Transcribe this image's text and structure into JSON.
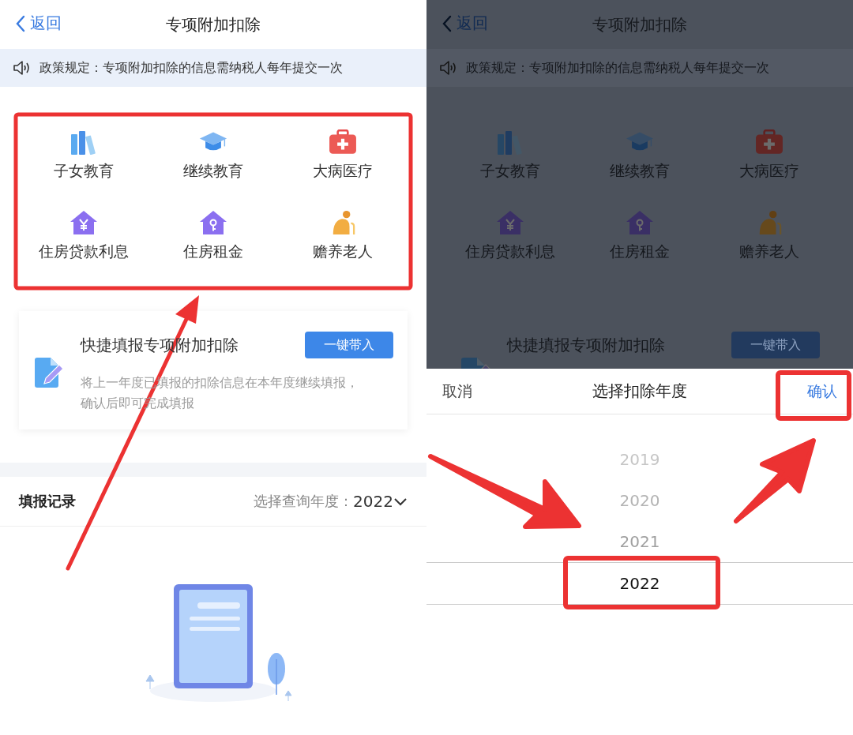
{
  "screens": [
    {
      "back": "返回",
      "title": "专项附加扣除",
      "notice": "政策规定：专项附加扣除的信息需纳税人每年提交一次",
      "categories": [
        {
          "label": "子女教育"
        },
        {
          "label": "继续教育"
        },
        {
          "label": "大病医疗"
        },
        {
          "label": "住房贷款利息"
        },
        {
          "label": "住房租金"
        },
        {
          "label": "赡养老人"
        }
      ],
      "quick_fill": {
        "title": "快捷填报专项附加扣除",
        "button": "一键带入",
        "description": "将上一年度已填报的扣除信息在本年度继续填报，确认后即可完成填报"
      },
      "records": {
        "title": "填报记录",
        "year_label": "选择查询年度：",
        "year": "2022"
      }
    },
    {
      "back": "返回",
      "title": "专项附加扣除",
      "notice": "政策规定：专项附加扣除的信息需纳税人每年提交一次",
      "categories": [
        {
          "label": "子女教育"
        },
        {
          "label": "继续教育"
        },
        {
          "label": "大病医疗"
        },
        {
          "label": "住房贷款利息"
        },
        {
          "label": "住房租金"
        },
        {
          "label": "赡养老人"
        }
      ],
      "quick_fill": {
        "title": "快捷填报专项附加扣除",
        "button": "一键带入"
      },
      "picker": {
        "cancel": "取消",
        "title": "选择扣除年度",
        "confirm": "确认",
        "years": [
          {
            "label": "2019",
            "selected": false
          },
          {
            "label": "2020",
            "selected": false
          },
          {
            "label": "2021",
            "selected": false
          },
          {
            "label": "2022",
            "selected": true
          }
        ]
      }
    }
  ]
}
